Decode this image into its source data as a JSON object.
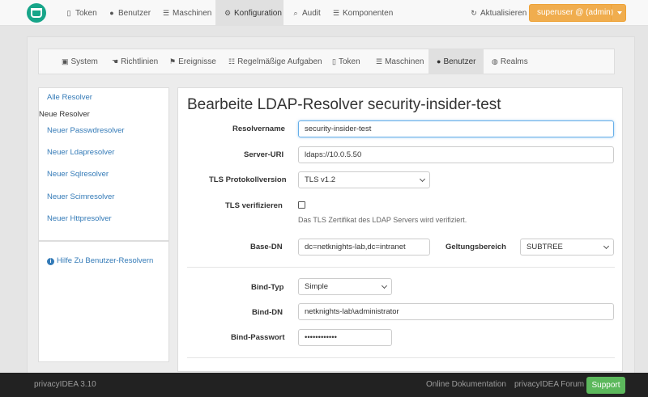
{
  "topnav": {
    "items": [
      {
        "label": "Token",
        "icon": "phone-icon"
      },
      {
        "label": "Benutzer",
        "icon": "user-icon"
      },
      {
        "label": "Maschinen",
        "icon": "server-icon"
      },
      {
        "label": "Konfiguration",
        "icon": "gear-icon",
        "active": true
      },
      {
        "label": "Audit",
        "icon": "search-icon"
      },
      {
        "label": "Komponenten",
        "icon": "server-icon"
      }
    ],
    "refresh_label": "Aktualisieren",
    "user_label": "superuser @ (admin)"
  },
  "config_tabs": [
    {
      "label": "System",
      "icon": "bank-icon"
    },
    {
      "label": "Richtlinien",
      "icon": "hand-icon"
    },
    {
      "label": "Ereignisse",
      "icon": "flag-icon"
    },
    {
      "label": "Regelmäßige Aufgaben",
      "icon": "list-icon"
    },
    {
      "label": "Token",
      "icon": "phone-icon"
    },
    {
      "label": "Maschinen",
      "icon": "server-icon"
    },
    {
      "label": "Benutzer",
      "icon": "user-icon",
      "active": true
    },
    {
      "label": "Realms",
      "icon": "globe-icon"
    }
  ],
  "sidebar": {
    "all_resolvers": "Alle Resolver",
    "new_resolver": "Neue Resolver",
    "links": [
      "Neuer Passwdresolver",
      "Neuer Ldapresolver",
      "Neuer Sqlresolver",
      "Neuer Scimresolver",
      "Neuer Httpresolver"
    ],
    "help": "Hilfe Zu Benutzer-Resolvern"
  },
  "form": {
    "title": "Bearbeite LDAP-Resolver security-insider-test",
    "resolvername_label": "Resolvername",
    "resolvername_value": "security-insider-test",
    "server_uri_label": "Server-URI",
    "server_uri_value": "ldaps://10.0.5.50",
    "tls_version_label": "TLS Protokollversion",
    "tls_version_value": "TLS v1.2",
    "tls_verify_label": "TLS verifizieren",
    "tls_verify_checked": false,
    "tls_verify_help": "Das TLS Zertifikat des LDAP Servers wird verifiziert.",
    "base_dn_label": "Base-DN",
    "base_dn_value": "dc=netknights-lab,dc=intranet",
    "scope_label": "Geltungsbereich",
    "scope_value": "SUBTREE",
    "bind_type_label": "Bind-Typ",
    "bind_type_value": "Simple",
    "bind_dn_label": "Bind-DN",
    "bind_dn_value": "netknights-lab\\administrator",
    "bind_password_label": "Bind-Passwort",
    "bind_password_value": "••••••••••••"
  },
  "footer": {
    "version": "privacyIDEA 3.10",
    "docs": "Online Dokumentation",
    "forum": "privacyIDEA Forum",
    "support": "Support"
  },
  "colors": {
    "accent": "#337ab7",
    "user_button": "#f0ad4e",
    "support_button": "#5cb85c",
    "logo": "#17a589"
  }
}
